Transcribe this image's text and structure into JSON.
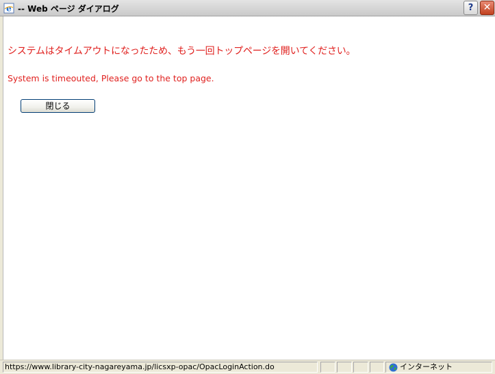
{
  "window": {
    "title": "-- Web ページ ダイアログ",
    "help_label": "?",
    "close_label": "✕"
  },
  "content": {
    "message_ja": "システムはタイムアウトになったため、もう一回トップページを開いてください。",
    "message_en": "System is timeouted, Please go to the top page.",
    "close_button_label": "閉じる",
    "message_color": "#e0211f"
  },
  "statusbar": {
    "url": "https://www.library-city-nagareyama.jp/licsxp-opac/OpacLoginAction.do",
    "zone_label": "インターネット",
    "zone_icon": "globe-icon"
  },
  "icons": {
    "title_icon": "ie-page-icon"
  }
}
